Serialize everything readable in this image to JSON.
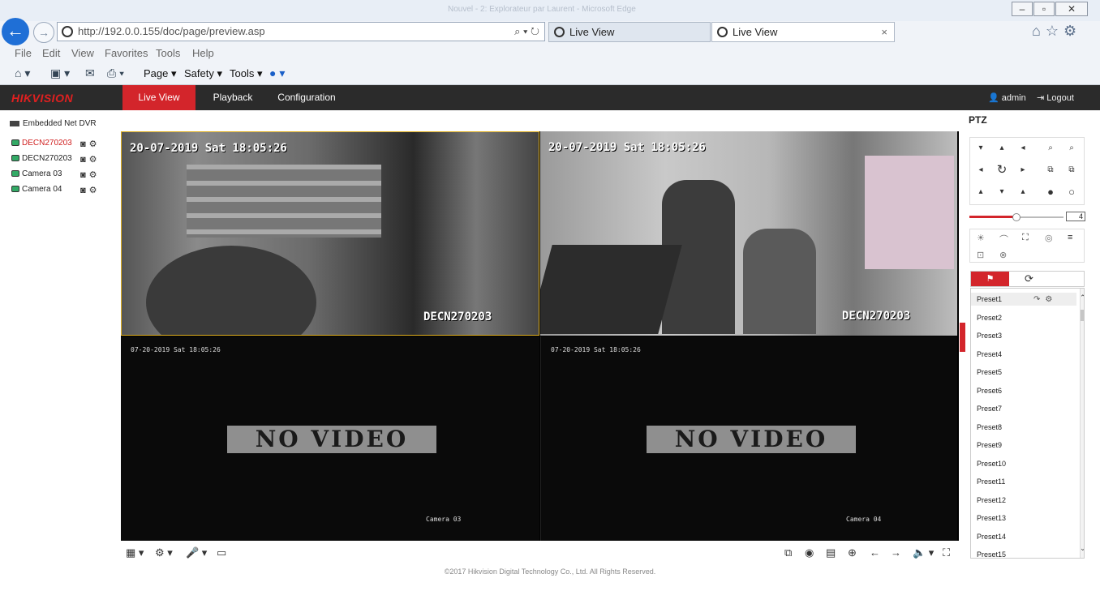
{
  "browser": {
    "window_title": "Nouvel - 2: Explorateur par Laurent - Microsoft Edge",
    "url": "http://192.0.0.155/doc/page/preview.asp",
    "tabs": [
      {
        "label": "Live View"
      },
      {
        "label": "Live View",
        "close": "×"
      }
    ],
    "menu": [
      "File",
      "Edit",
      "View",
      "Favorites",
      "Tools",
      "Help"
    ],
    "commands": [
      "Page ▾",
      "Safety ▾",
      "Tools ▾"
    ]
  },
  "app": {
    "logo": "HIKVISION",
    "nav": [
      "Live View",
      "Playback",
      "Configuration"
    ],
    "user": "admin",
    "logout": "Logout",
    "accent": "#d3252b"
  },
  "tree": {
    "root": "Embedded Net DVR",
    "cameras": [
      "DECN270203",
      "DECN270203",
      "Camera 03",
      "Camera 04"
    ]
  },
  "video": {
    "panes": [
      {
        "timestamp": "20-07-2019 Sat 18:05:26",
        "label": "DECN270203"
      },
      {
        "timestamp": "20-07-2019 Sat 18:05:26",
        "label": "DECN270203"
      },
      {
        "timestamp": "07-20-2019 Sat 18:05:26",
        "label": "Camera 03",
        "status": "NO VIDEO"
      },
      {
        "timestamp": "07-20-2019 Sat 18:05:26",
        "label": "Camera 04",
        "status": "NO VIDEO"
      }
    ]
  },
  "footer": "©2017 Hikvision Digital Technology Co., Ltd. All Rights Reserved.",
  "ptz": {
    "title": "PTZ",
    "speed": "4",
    "speed_level": 0.5,
    "presets": [
      "Preset1",
      "Preset2",
      "Preset3",
      "Preset4",
      "Preset5",
      "Preset6",
      "Preset7",
      "Preset8",
      "Preset9",
      "Preset10",
      "Preset11",
      "Preset12",
      "Preset13",
      "Preset14",
      "Preset15"
    ]
  }
}
